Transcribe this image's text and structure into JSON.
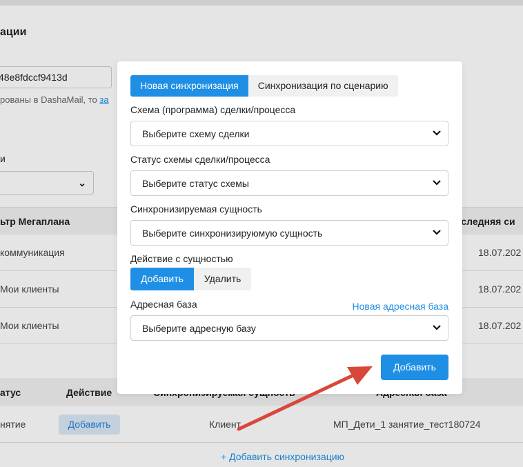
{
  "background": {
    "title": "ации",
    "key_field": "48e8fdccf9413d",
    "hint_text": "рованы в DashaMail, то ",
    "hint_link": "за",
    "filter_label": "и",
    "table1": {
      "col_filter": "ьтр Мегаплана",
      "col_last_sync": "оследняя си",
      "rows": [
        {
          "name": " коммуникация",
          "date": "18.07.202"
        },
        {
          "name": "Мои клиенты",
          "date": "18.07.202"
        },
        {
          "name": "Мои клиенты",
          "date": "18.07.202"
        }
      ]
    },
    "table2": {
      "col_status": "атус",
      "col_action": "Действие",
      "col_entity": "Синхронизируемая сущность",
      "col_base": "Адресная база",
      "row": {
        "status": "нятие",
        "action_button": "Добавить",
        "entity": "Клиент",
        "base": "МП_Дети_1 занятие_тест180724"
      }
    },
    "add_sync_link": "+ Добавить синхронизацию"
  },
  "modal": {
    "tabs": {
      "active": "Новая синхронизация",
      "inactive": "Синхронизация по сценарию"
    },
    "scheme_label": "Схема (программа) сделки/процесса",
    "scheme_value": "Выберите схему сделки",
    "status_label": "Статус схемы сделки/процесса",
    "status_value": "Выберите статус схемы",
    "entity_label": "Синхронизируемая сущность",
    "entity_value": "Выберите синхронизирую​мую сущность",
    "action_label": "Действие с сущностью",
    "action_add": "Добавить",
    "action_delete": "Удалить",
    "base_label": "Адресная база",
    "new_base_link": "Новая адресная база",
    "base_value": "Выберите адресную базу",
    "submit_label": "Добавить"
  },
  "colors": {
    "accent": "#1f8fe5",
    "annotation_arrow": "#d9473a"
  }
}
